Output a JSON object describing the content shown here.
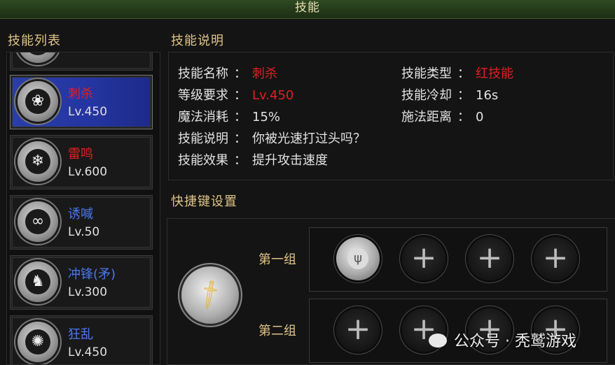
{
  "window": {
    "title": "技能"
  },
  "skill_list": {
    "heading": "技能列表",
    "items": [
      {
        "name": "刺杀",
        "level": "Lv.450",
        "color": "#e02020",
        "icon": "lotus-icon",
        "selected": true
      },
      {
        "name": "雷鸣",
        "level": "Lv.600",
        "color": "#e02020",
        "icon": "snowflake-burst-icon",
        "selected": false
      },
      {
        "name": "诱喊",
        "level": "Lv.50",
        "color": "#4a78f0",
        "icon": "swirl-icon",
        "selected": false
      },
      {
        "name": "冲锋(矛)",
        "level": "Lv.300",
        "color": "#4a78f0",
        "icon": "beast-icon",
        "selected": false
      },
      {
        "name": "狂乱",
        "level": "Lv.450",
        "color": "#4a78f0",
        "icon": "rune-icon",
        "selected": false
      }
    ]
  },
  "description": {
    "heading": "技能说明",
    "separator": "：",
    "skill_name_label": "技能名称",
    "skill_name_value": "刺杀",
    "skill_type_label": "技能类型",
    "skill_type_value": "红技能",
    "level_req_label": "等级要求",
    "level_req_value": "Lv.450",
    "cooldown_label": "技能冷却",
    "cooldown_value": "16s",
    "mana_label": "魔法消耗",
    "mana_value": "15%",
    "range_label": "施法距离",
    "range_value": "0",
    "desc_label": "技能说明",
    "desc_value": "你被光速打过头吗？",
    "effect_label": "技能效果",
    "effect_value": "提升攻击速度"
  },
  "hotkeys": {
    "heading": "快捷键设置",
    "current_icon": "sword-icon",
    "groups": [
      {
        "label": "第一组",
        "slots": [
          "filled",
          "empty",
          "empty",
          "empty"
        ]
      },
      {
        "label": "第二组",
        "slots": [
          "empty",
          "empty",
          "empty",
          "empty"
        ]
      }
    ]
  },
  "watermark": {
    "text": "公众号 · 秃鹫游戏"
  },
  "colors": {
    "accent_red": "#e02020",
    "accent_blue": "#4a78f0",
    "selected_bg": "#2434a0",
    "heading_gold": "#e0c488"
  }
}
